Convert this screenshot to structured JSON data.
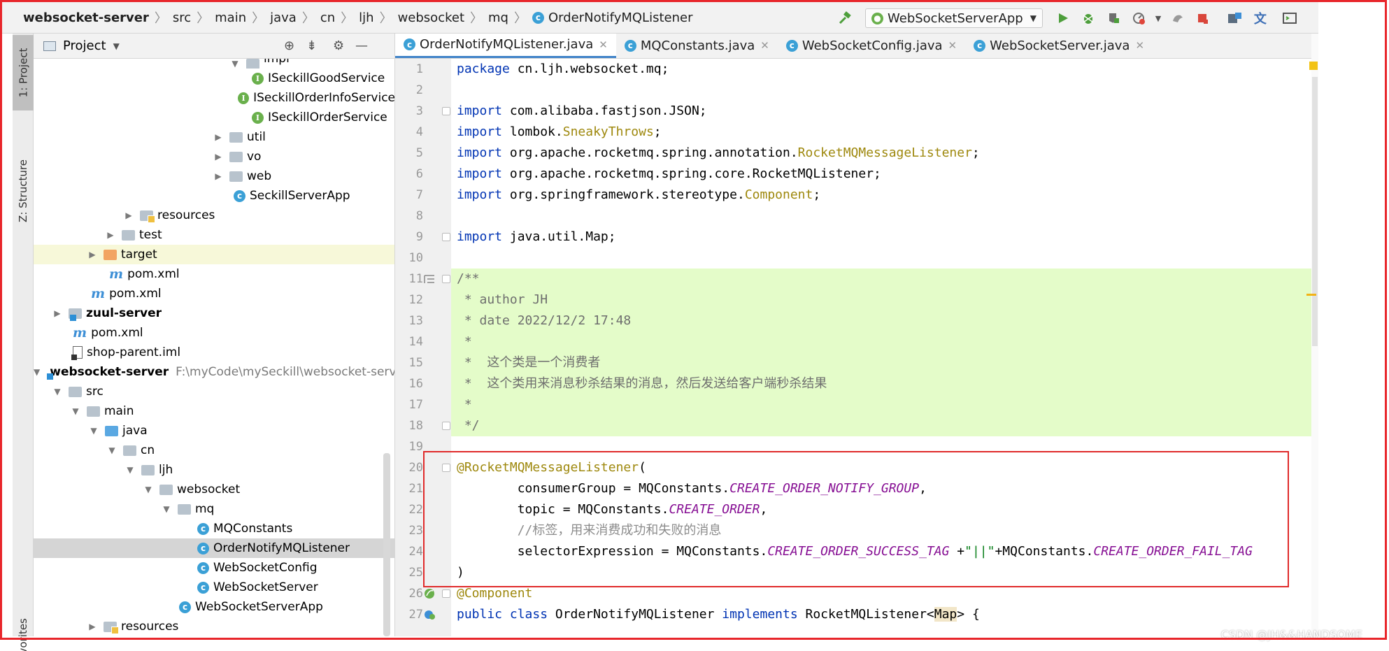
{
  "breadcrumb": [
    "websocket-server",
    "src",
    "main",
    "java",
    "cn",
    "ljh",
    "websocket",
    "mq",
    "OrderNotifyMQListener"
  ],
  "toolbar": {
    "run_config": "WebSocketServerApp"
  },
  "tool_windows": {
    "project": "1: Project",
    "structure": "Z: Structure",
    "favorites": "Favorites"
  },
  "project_panel": {
    "title": "Project",
    "tree": [
      {
        "label": "impl",
        "icon": "folder"
      },
      {
        "label": "ISeckillGoodService",
        "icon": "interface"
      },
      {
        "label": "ISeckillOrderInfoService",
        "icon": "interface"
      },
      {
        "label": "ISeckillOrderService",
        "icon": "interface"
      },
      {
        "label": "util",
        "icon": "folder"
      },
      {
        "label": "vo",
        "icon": "folder"
      },
      {
        "label": "web",
        "icon": "folder"
      },
      {
        "label": "SeckillServerApp",
        "icon": "spring-class"
      },
      {
        "label": "resources",
        "icon": "resources-folder"
      },
      {
        "label": "test",
        "icon": "folder"
      },
      {
        "label": "target",
        "icon": "orange-folder"
      },
      {
        "label": "pom.xml",
        "icon": "maven"
      },
      {
        "label": "pom.xml",
        "icon": "maven"
      },
      {
        "label": "zuul-server",
        "icon": "module-folder"
      },
      {
        "label": "pom.xml",
        "icon": "maven"
      },
      {
        "label": "shop-parent.iml",
        "icon": "iml"
      },
      {
        "label": "websocket-server",
        "icon": "module-folder",
        "path": "F:\\myCode\\mySeckill\\websocket-server"
      },
      {
        "label": "src",
        "icon": "folder"
      },
      {
        "label": "main",
        "icon": "folder"
      },
      {
        "label": "java",
        "icon": "source-folder"
      },
      {
        "label": "cn",
        "icon": "folder"
      },
      {
        "label": "ljh",
        "icon": "folder"
      },
      {
        "label": "websocket",
        "icon": "folder"
      },
      {
        "label": "mq",
        "icon": "folder"
      },
      {
        "label": "MQConstants",
        "icon": "class"
      },
      {
        "label": "OrderNotifyMQListener",
        "icon": "class",
        "selected": true
      },
      {
        "label": "WebSocketConfig",
        "icon": "class"
      },
      {
        "label": "WebSocketServer",
        "icon": "class"
      },
      {
        "label": "WebSocketServerApp",
        "icon": "spring-class"
      },
      {
        "label": "resources",
        "icon": "resources-folder"
      }
    ]
  },
  "tabs": [
    {
      "label": "OrderNotifyMQListener.java",
      "active": true
    },
    {
      "label": "MQConstants.java"
    },
    {
      "label": "WebSocketConfig.java"
    },
    {
      "label": "WebSocketServer.java"
    }
  ],
  "editor": {
    "line_numbers": [
      "1",
      "2",
      "3",
      "4",
      "5",
      "6",
      "7",
      "8",
      "9",
      "10",
      "11",
      "12",
      "13",
      "14",
      "15",
      "16",
      "17",
      "18",
      "19",
      "20",
      "21",
      "22",
      "23",
      "24",
      "25",
      "26",
      "27"
    ],
    "lines": [
      {
        "tokens": [
          {
            "t": "package",
            "c": "kw"
          },
          {
            "t": " cn.ljh.websocket.mq;"
          }
        ]
      },
      {
        "tokens": []
      },
      {
        "tokens": [
          {
            "t": "import",
            "c": "kw"
          },
          {
            "t": " com.alibaba.fastjson.JSON;"
          }
        ]
      },
      {
        "tokens": [
          {
            "t": "import",
            "c": "kw"
          },
          {
            "t": " lombok."
          },
          {
            "t": "SneakyThrows",
            "c": "ann"
          },
          {
            "t": ";"
          }
        ]
      },
      {
        "tokens": [
          {
            "t": "import",
            "c": "kw"
          },
          {
            "t": " org.apache.rocketmq.spring.annotation."
          },
          {
            "t": "RocketMQMessageListener",
            "c": "ann"
          },
          {
            "t": ";"
          }
        ]
      },
      {
        "tokens": [
          {
            "t": "import",
            "c": "kw"
          },
          {
            "t": " org.apache.rocketmq.spring.core.RocketMQListener;"
          }
        ]
      },
      {
        "tokens": [
          {
            "t": "import",
            "c": "kw"
          },
          {
            "t": " org.springframework.stereotype."
          },
          {
            "t": "Component",
            "c": "ann"
          },
          {
            "t": ";"
          }
        ]
      },
      {
        "tokens": []
      },
      {
        "tokens": [
          {
            "t": "import",
            "c": "kw"
          },
          {
            "t": " java.util.Map;"
          }
        ]
      },
      {
        "tokens": []
      },
      {
        "doc": true,
        "tokens": [
          {
            "t": "/**",
            "c": "dc"
          }
        ]
      },
      {
        "doc": true,
        "tokens": [
          {
            "t": " * author JH",
            "c": "dc"
          }
        ]
      },
      {
        "doc": true,
        "tokens": [
          {
            "t": " * date 2022/12/2 17:48",
            "c": "dc"
          }
        ]
      },
      {
        "doc": true,
        "tokens": [
          {
            "t": " *",
            "c": "dc"
          }
        ]
      },
      {
        "doc": true,
        "tokens": [
          {
            "t": " *  这个类是一个消费者",
            "c": "dc"
          }
        ]
      },
      {
        "doc": true,
        "tokens": [
          {
            "t": " *  这个类用来消息秒杀结果的消息，然后发送给客户端秒杀结果",
            "c": "dc"
          }
        ]
      },
      {
        "doc": true,
        "tokens": [
          {
            "t": " *",
            "c": "dc"
          }
        ]
      },
      {
        "doc": true,
        "tokens": [
          {
            "t": " */",
            "c": "dc"
          }
        ]
      },
      {
        "tokens": []
      },
      {
        "tokens": [
          {
            "t": "@RocketMQMessageListener",
            "c": "ann"
          },
          {
            "t": "("
          }
        ]
      },
      {
        "tokens": [
          {
            "t": "        consumerGroup = MQConstants."
          },
          {
            "t": "CREATE_ORDER_NOTIFY_GROUP",
            "c": "cn"
          },
          {
            "t": ","
          }
        ]
      },
      {
        "tokens": [
          {
            "t": "        topic = MQConstants."
          },
          {
            "t": "CREATE_ORDER",
            "c": "cn"
          },
          {
            "t": ","
          }
        ]
      },
      {
        "tokens": [
          {
            "t": "        //标签，用来消费成功和失败的消息",
            "c": "cm"
          }
        ]
      },
      {
        "tokens": [
          {
            "t": "        selectorExpression = MQConstants."
          },
          {
            "t": "CREATE_ORDER_SUCCESS_TAG",
            "c": "cn"
          },
          {
            "t": " +"
          },
          {
            "t": "\"||\"",
            "c": "str"
          },
          {
            "t": "+MQConstants."
          },
          {
            "t": "CREATE_ORDER_FAIL_TAG",
            "c": "cn"
          }
        ]
      },
      {
        "tokens": [
          {
            "t": ")"
          }
        ]
      },
      {
        "tokens": [
          {
            "t": "@Component",
            "c": "ann"
          }
        ]
      },
      {
        "tokens": [
          {
            "t": "public class",
            "c": "kw"
          },
          {
            "t": " OrderNotifyMQListener "
          },
          {
            "t": "implements",
            "c": "kw"
          },
          {
            "t": " RocketMQListener<"
          },
          {
            "t": "Map",
            "c": "hlt"
          },
          {
            "t": "> {"
          }
        ]
      }
    ]
  },
  "watermark": "CSDN @JH&&HANDSOME"
}
